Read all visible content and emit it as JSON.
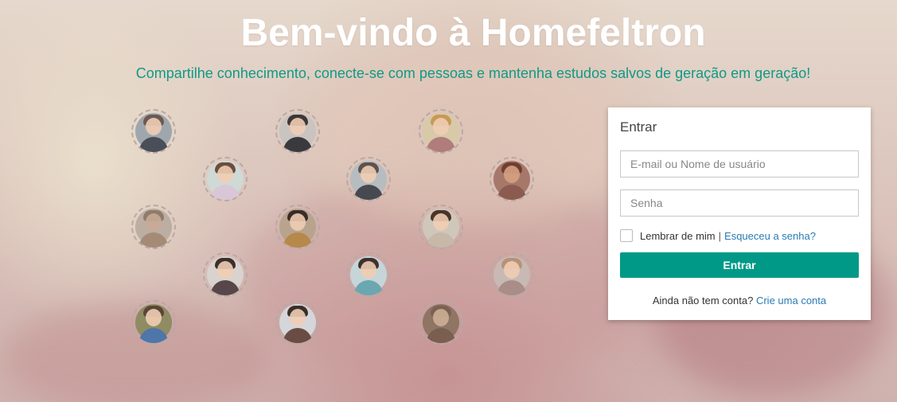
{
  "header": {
    "title": "Bem-vindo à Homefeltron",
    "subtitle": "Compartilhe conhecimento, conecte-se com pessoas e mantenha estudos salvos de geração em geração!"
  },
  "login": {
    "title": "Entrar",
    "email_placeholder": "E-mail ou Nome de usuário",
    "password_placeholder": "Senha",
    "remember_label": "Lembrar de mim",
    "separator": "|",
    "forgot_link": "Esqueceu a senha?",
    "submit_label": "Entrar",
    "signup_prompt": "Ainda não tem conta?",
    "signup_link": "Crie uma conta"
  },
  "colors": {
    "accent": "#009987",
    "subtitle": "#0f9a86",
    "link": "#2a7bb5"
  }
}
